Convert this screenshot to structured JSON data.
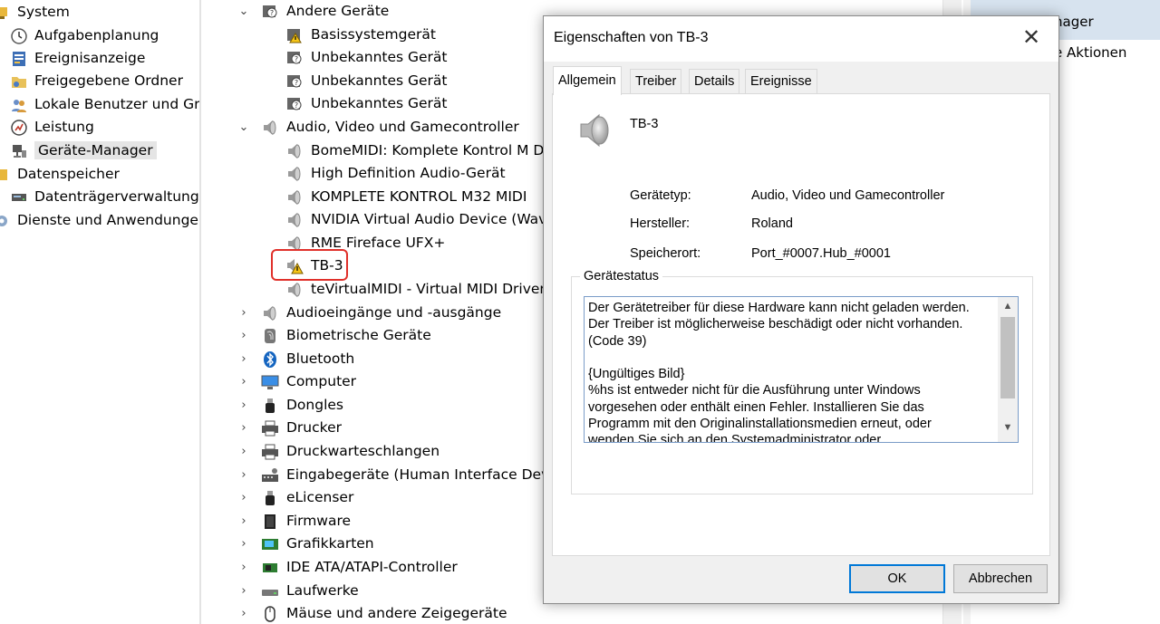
{
  "left_tree": {
    "items": [
      {
        "label": "System",
        "icon": "system-icon"
      },
      {
        "label": "Aufgabenplanung",
        "icon": "clock-icon"
      },
      {
        "label": "Ereignisanzeige",
        "icon": "event-viewer-icon"
      },
      {
        "label": "Freigegebene Ordner",
        "icon": "shared-folder-icon"
      },
      {
        "label": "Lokale Benutzer und Gru",
        "icon": "users-icon"
      },
      {
        "label": "Leistung",
        "icon": "performance-icon"
      },
      {
        "label": "Geräte-Manager",
        "icon": "device-manager-icon"
      },
      {
        "label": "Datenspeicher",
        "icon": "storage-icon"
      },
      {
        "label": "Datenträgerverwaltung",
        "icon": "disk-icon"
      },
      {
        "label": "Dienste und Anwendungen",
        "icon": "services-icon"
      }
    ]
  },
  "device_tree": {
    "rows": [
      {
        "label": "Andere Geräte",
        "expander": "⌄",
        "icon": "unknown-device-icon"
      },
      {
        "label": "Basissystemgerät",
        "icon": "warning-device-icon"
      },
      {
        "label": "Unbekanntes Gerät",
        "icon": "unknown-device-icon"
      },
      {
        "label": "Unbekanntes Gerät",
        "icon": "unknown-device-icon"
      },
      {
        "label": "Unbekanntes Gerät",
        "icon": "unknown-device-icon"
      },
      {
        "label": "Audio, Video und Gamecontroller",
        "expander": "⌄",
        "icon": "speaker-icon"
      },
      {
        "label": "BomeMIDI: Komplete Kontrol M DA",
        "icon": "speaker-icon"
      },
      {
        "label": "High Definition Audio-Gerät",
        "icon": "speaker-icon"
      },
      {
        "label": "KOMPLETE KONTROL M32 MIDI",
        "icon": "speaker-icon"
      },
      {
        "label": "NVIDIA Virtual Audio Device (Wave",
        "icon": "speaker-icon"
      },
      {
        "label": "RME Fireface UFX+",
        "icon": "speaker-icon"
      },
      {
        "label": "TB-3",
        "icon": "speaker-warning-icon"
      },
      {
        "label": "teVirtualMIDI - Virtual MIDI Driver",
        "icon": "speaker-icon"
      },
      {
        "label": "Audioeingänge und -ausgänge",
        "expander": "›",
        "icon": "speaker-icon"
      },
      {
        "label": "Biometrische Geräte",
        "expander": "›",
        "icon": "fingerprint-icon"
      },
      {
        "label": "Bluetooth",
        "expander": "›",
        "icon": "bluetooth-icon"
      },
      {
        "label": "Computer",
        "expander": "›",
        "icon": "monitor-icon"
      },
      {
        "label": "Dongles",
        "expander": "›",
        "icon": "dongle-icon"
      },
      {
        "label": "Drucker",
        "expander": "›",
        "icon": "printer-icon"
      },
      {
        "label": "Druckwarteschlangen",
        "expander": "›",
        "icon": "printer-icon"
      },
      {
        "label": "Eingabegeräte (Human Interface Devic",
        "expander": "›",
        "icon": "hid-icon"
      },
      {
        "label": "eLicenser",
        "expander": "›",
        "icon": "dongle-icon"
      },
      {
        "label": "Firmware",
        "expander": "›",
        "icon": "chip-icon"
      },
      {
        "label": "Grafikkarten",
        "expander": "›",
        "icon": "display-adapter-icon"
      },
      {
        "label": "IDE ATA/ATAPI-Controller",
        "expander": "›",
        "icon": "controller-icon"
      },
      {
        "label": "Laufwerke",
        "expander": "›",
        "icon": "drive-icon"
      },
      {
        "label": "Mäuse und andere Zeigegeräte",
        "expander": "›",
        "icon": "mouse-icon"
      }
    ]
  },
  "actions": {
    "header": "nager",
    "item": "e Aktionen"
  },
  "dialog": {
    "title": "Eigenschaften von TB-3",
    "close": "✕",
    "tabs": [
      "Allgemein",
      "Treiber",
      "Details",
      "Ereignisse"
    ],
    "device_name": "TB-3",
    "properties": [
      {
        "label": "Gerätetyp:",
        "value": "Audio, Video und Gamecontroller"
      },
      {
        "label": "Hersteller:",
        "value": "Roland"
      },
      {
        "label": "Speicherort:",
        "value": "Port_#0007.Hub_#0001"
      }
    ],
    "status_caption": "Gerätestatus",
    "status_text": "Der Gerätetreiber für diese Hardware kann nicht geladen werden.\nDer Treiber ist möglicherweise beschädigt oder nicht vorhanden.\n(Code 39)\n\n{Ungültiges Bild}\n%hs ist entweder nicht für die Ausführung unter Windows\nvorgesehen oder enthält einen Fehler. Installieren Sie das\nProgramm mit den Originalinstallationsmedien erneut, oder\nwenden Sie sich an den Systemadministrator oder",
    "ok_label": "OK",
    "cancel_label": "Abbrechen"
  },
  "colors": {
    "highlight": "#e0302a",
    "accent": "#0078d7",
    "selection": "#e5e5e5"
  }
}
